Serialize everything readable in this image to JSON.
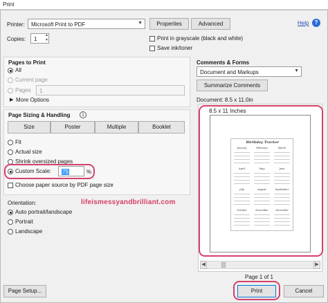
{
  "window": {
    "title": "Print"
  },
  "printer": {
    "label": "Printer:",
    "selected": "Microsoft Print to PDF",
    "properties_label": "Properties",
    "advanced_label": "Advanced",
    "help_label": "Help",
    "help_icon": "help-circle-icon"
  },
  "copies": {
    "label": "Copies:",
    "value": "1"
  },
  "options": {
    "grayscale_label": "Print in grayscale (black and white)",
    "save_ink_label": "Save ink/toner"
  },
  "pages_to_print": {
    "title": "Pages to Print",
    "all_label": "All",
    "current_label": "Current page",
    "pages_label": "Pages",
    "pages_value": "1",
    "more_options_label": "More Options"
  },
  "sizing": {
    "title": "Page Sizing & Handling",
    "info_icon": "info-icon",
    "tabs": [
      "Size",
      "Poster",
      "Multiple",
      "Booklet"
    ],
    "fit_label": "Fit",
    "actual_label": "Actual size",
    "shrink_label": "Shrink oversized pages",
    "custom_label": "Custom Scale:",
    "custom_value": "75",
    "custom_unit": "%",
    "paper_source_label": "Choose paper source by PDF page size"
  },
  "orientation": {
    "title": "Orientation:",
    "auto_label": "Auto portrait/landscape",
    "portrait_label": "Portrait",
    "landscape_label": "Landscape"
  },
  "watermark": {
    "text": "lifeismessyandbrilliant.com",
    "color": "#d6406a"
  },
  "comments": {
    "title": "Comments & Forms",
    "selected": "Document and Markups",
    "summarize_label": "Summarize Comments"
  },
  "preview": {
    "document_label": "Document: 8.5 x 11.0in",
    "paper_label": "8.5 x 11 Inches",
    "sheet_title": "Birthday Tracker",
    "months": [
      "January",
      "February",
      "March",
      "April",
      "May",
      "June",
      "July",
      "August",
      "September",
      "October",
      "November",
      "December"
    ],
    "page_indicator": "Page 1 of 1"
  },
  "footer": {
    "page_setup_label": "Page Setup...",
    "print_label": "Print",
    "cancel_label": "Cancel"
  },
  "colors": {
    "accent": "#d6406a",
    "link": "#1d4fb8",
    "selection": "#3399ff"
  }
}
